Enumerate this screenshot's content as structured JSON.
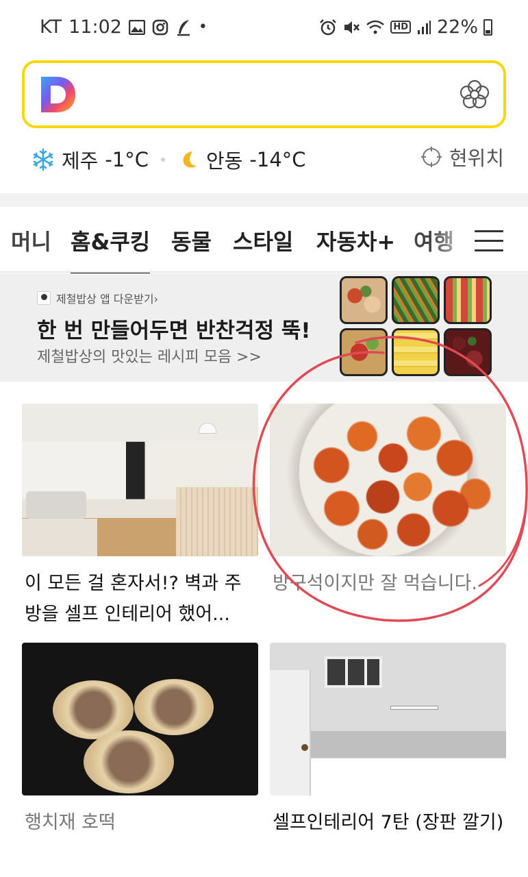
{
  "status_bar": {
    "carrier": "KT",
    "time": "11:02",
    "dot": "•",
    "battery": "22%",
    "hd": "HD",
    "icons": [
      "gallery-icon",
      "instagram-icon",
      "feather-icon",
      "alarm-icon",
      "mute-icon",
      "wifi-icon",
      "hd-icon",
      "signal-icon",
      "battery-icon"
    ]
  },
  "search": {
    "placeholder": "",
    "logo_letter": "D"
  },
  "weather": {
    "left": {
      "city": "제주",
      "temp": "-1°C",
      "icon": "snowflake-icon"
    },
    "right": {
      "city": "안동",
      "temp": "-14°C",
      "icon": "moon-icon"
    },
    "location_label": "현위치"
  },
  "tabs": [
    {
      "label": "머니"
    },
    {
      "label": "홈&쿠킹"
    },
    {
      "label": "동물"
    },
    {
      "label": "스타일"
    },
    {
      "label": "자동차+"
    },
    {
      "label": "여행"
    }
  ],
  "banner": {
    "source": "제철밥상 앱 다운받기›",
    "title": "한 번 만들어두면 반찬걱정 뚝!",
    "subtitle": "제철밥상의 맛있는 레시피 모음 >>"
  },
  "feed": [
    {
      "title": "이 모든 걸 혼자서!? 벽과 주방을 셀프 인테리어 했어..."
    },
    {
      "title": "방구석이지만 잘 먹습니다."
    },
    {
      "title": "행치재 호떡"
    },
    {
      "title": "셀프인테리어 7탄 (장판 깔기)"
    }
  ],
  "colors": {
    "search_border": "#f5d90c",
    "annotation_red": "#e04a55"
  }
}
